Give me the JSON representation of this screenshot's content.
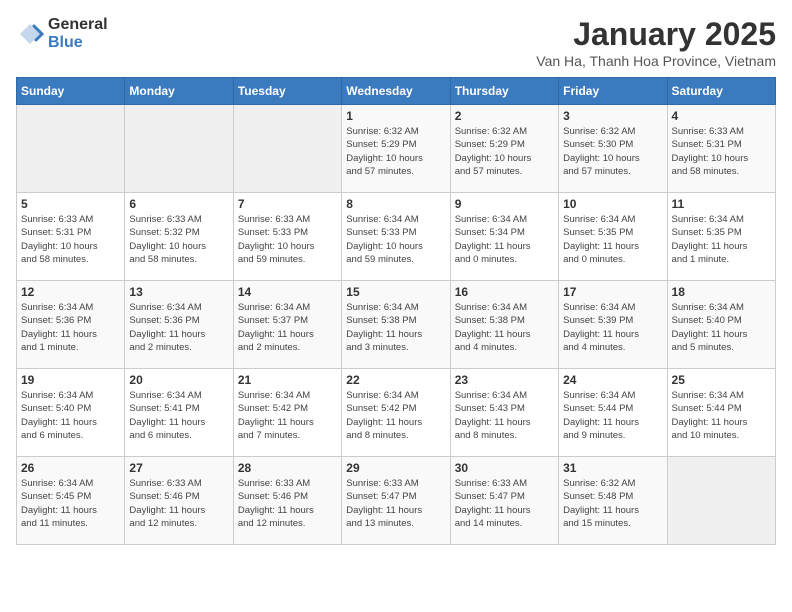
{
  "logo": {
    "general": "General",
    "blue": "Blue"
  },
  "header": {
    "month": "January 2025",
    "location": "Van Ha, Thanh Hoa Province, Vietnam"
  },
  "weekdays": [
    "Sunday",
    "Monday",
    "Tuesday",
    "Wednesday",
    "Thursday",
    "Friday",
    "Saturday"
  ],
  "weeks": [
    [
      {
        "day": "",
        "info": ""
      },
      {
        "day": "",
        "info": ""
      },
      {
        "day": "",
        "info": ""
      },
      {
        "day": "1",
        "info": "Sunrise: 6:32 AM\nSunset: 5:29 PM\nDaylight: 10 hours\nand 57 minutes."
      },
      {
        "day": "2",
        "info": "Sunrise: 6:32 AM\nSunset: 5:29 PM\nDaylight: 10 hours\nand 57 minutes."
      },
      {
        "day": "3",
        "info": "Sunrise: 6:32 AM\nSunset: 5:30 PM\nDaylight: 10 hours\nand 57 minutes."
      },
      {
        "day": "4",
        "info": "Sunrise: 6:33 AM\nSunset: 5:31 PM\nDaylight: 10 hours\nand 58 minutes."
      }
    ],
    [
      {
        "day": "5",
        "info": "Sunrise: 6:33 AM\nSunset: 5:31 PM\nDaylight: 10 hours\nand 58 minutes."
      },
      {
        "day": "6",
        "info": "Sunrise: 6:33 AM\nSunset: 5:32 PM\nDaylight: 10 hours\nand 58 minutes."
      },
      {
        "day": "7",
        "info": "Sunrise: 6:33 AM\nSunset: 5:33 PM\nDaylight: 10 hours\nand 59 minutes."
      },
      {
        "day": "8",
        "info": "Sunrise: 6:34 AM\nSunset: 5:33 PM\nDaylight: 10 hours\nand 59 minutes."
      },
      {
        "day": "9",
        "info": "Sunrise: 6:34 AM\nSunset: 5:34 PM\nDaylight: 11 hours\nand 0 minutes."
      },
      {
        "day": "10",
        "info": "Sunrise: 6:34 AM\nSunset: 5:35 PM\nDaylight: 11 hours\nand 0 minutes."
      },
      {
        "day": "11",
        "info": "Sunrise: 6:34 AM\nSunset: 5:35 PM\nDaylight: 11 hours\nand 1 minute."
      }
    ],
    [
      {
        "day": "12",
        "info": "Sunrise: 6:34 AM\nSunset: 5:36 PM\nDaylight: 11 hours\nand 1 minute."
      },
      {
        "day": "13",
        "info": "Sunrise: 6:34 AM\nSunset: 5:36 PM\nDaylight: 11 hours\nand 2 minutes."
      },
      {
        "day": "14",
        "info": "Sunrise: 6:34 AM\nSunset: 5:37 PM\nDaylight: 11 hours\nand 2 minutes."
      },
      {
        "day": "15",
        "info": "Sunrise: 6:34 AM\nSunset: 5:38 PM\nDaylight: 11 hours\nand 3 minutes."
      },
      {
        "day": "16",
        "info": "Sunrise: 6:34 AM\nSunset: 5:38 PM\nDaylight: 11 hours\nand 4 minutes."
      },
      {
        "day": "17",
        "info": "Sunrise: 6:34 AM\nSunset: 5:39 PM\nDaylight: 11 hours\nand 4 minutes."
      },
      {
        "day": "18",
        "info": "Sunrise: 6:34 AM\nSunset: 5:40 PM\nDaylight: 11 hours\nand 5 minutes."
      }
    ],
    [
      {
        "day": "19",
        "info": "Sunrise: 6:34 AM\nSunset: 5:40 PM\nDaylight: 11 hours\nand 6 minutes."
      },
      {
        "day": "20",
        "info": "Sunrise: 6:34 AM\nSunset: 5:41 PM\nDaylight: 11 hours\nand 6 minutes."
      },
      {
        "day": "21",
        "info": "Sunrise: 6:34 AM\nSunset: 5:42 PM\nDaylight: 11 hours\nand 7 minutes."
      },
      {
        "day": "22",
        "info": "Sunrise: 6:34 AM\nSunset: 5:42 PM\nDaylight: 11 hours\nand 8 minutes."
      },
      {
        "day": "23",
        "info": "Sunrise: 6:34 AM\nSunset: 5:43 PM\nDaylight: 11 hours\nand 8 minutes."
      },
      {
        "day": "24",
        "info": "Sunrise: 6:34 AM\nSunset: 5:44 PM\nDaylight: 11 hours\nand 9 minutes."
      },
      {
        "day": "25",
        "info": "Sunrise: 6:34 AM\nSunset: 5:44 PM\nDaylight: 11 hours\nand 10 minutes."
      }
    ],
    [
      {
        "day": "26",
        "info": "Sunrise: 6:34 AM\nSunset: 5:45 PM\nDaylight: 11 hours\nand 11 minutes."
      },
      {
        "day": "27",
        "info": "Sunrise: 6:33 AM\nSunset: 5:46 PM\nDaylight: 11 hours\nand 12 minutes."
      },
      {
        "day": "28",
        "info": "Sunrise: 6:33 AM\nSunset: 5:46 PM\nDaylight: 11 hours\nand 12 minutes."
      },
      {
        "day": "29",
        "info": "Sunrise: 6:33 AM\nSunset: 5:47 PM\nDaylight: 11 hours\nand 13 minutes."
      },
      {
        "day": "30",
        "info": "Sunrise: 6:33 AM\nSunset: 5:47 PM\nDaylight: 11 hours\nand 14 minutes."
      },
      {
        "day": "31",
        "info": "Sunrise: 6:32 AM\nSunset: 5:48 PM\nDaylight: 11 hours\nand 15 minutes."
      },
      {
        "day": "",
        "info": ""
      }
    ]
  ]
}
